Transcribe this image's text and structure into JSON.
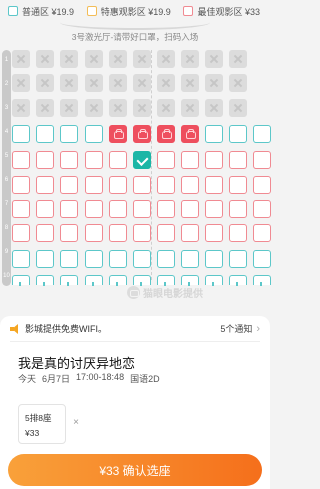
{
  "legend": [
    {
      "label": "普通区 ¥19.9",
      "color": "#5cc7c9"
    },
    {
      "label": "特惠观影区 ¥19.9",
      "color": "#f3bd57"
    },
    {
      "label": "最佳观影区 ¥33",
      "color": "#f08a92"
    }
  ],
  "screen": {
    "text": "3号激光厅-请带好口罩，扫码入场"
  },
  "row_numbers": [
    "1",
    "2",
    "3",
    "4",
    "5",
    "6",
    "7",
    "8",
    "9",
    "10"
  ],
  "watermark": {
    "text": "猫眼电影提供"
  },
  "notice": {
    "text": "影城提供免费WIFI。",
    "count": "5个通知",
    "chevron": "›"
  },
  "movie": {
    "title": "我是真的讨厌异地恋",
    "day": "今天",
    "date": "6月7日",
    "time": "17:00-18:48",
    "format": "国语2D"
  },
  "selected_seat": {
    "position": "5排8座",
    "price": "¥33",
    "remove": "×"
  },
  "confirm_button": {
    "label": "¥33 确认选座"
  }
}
